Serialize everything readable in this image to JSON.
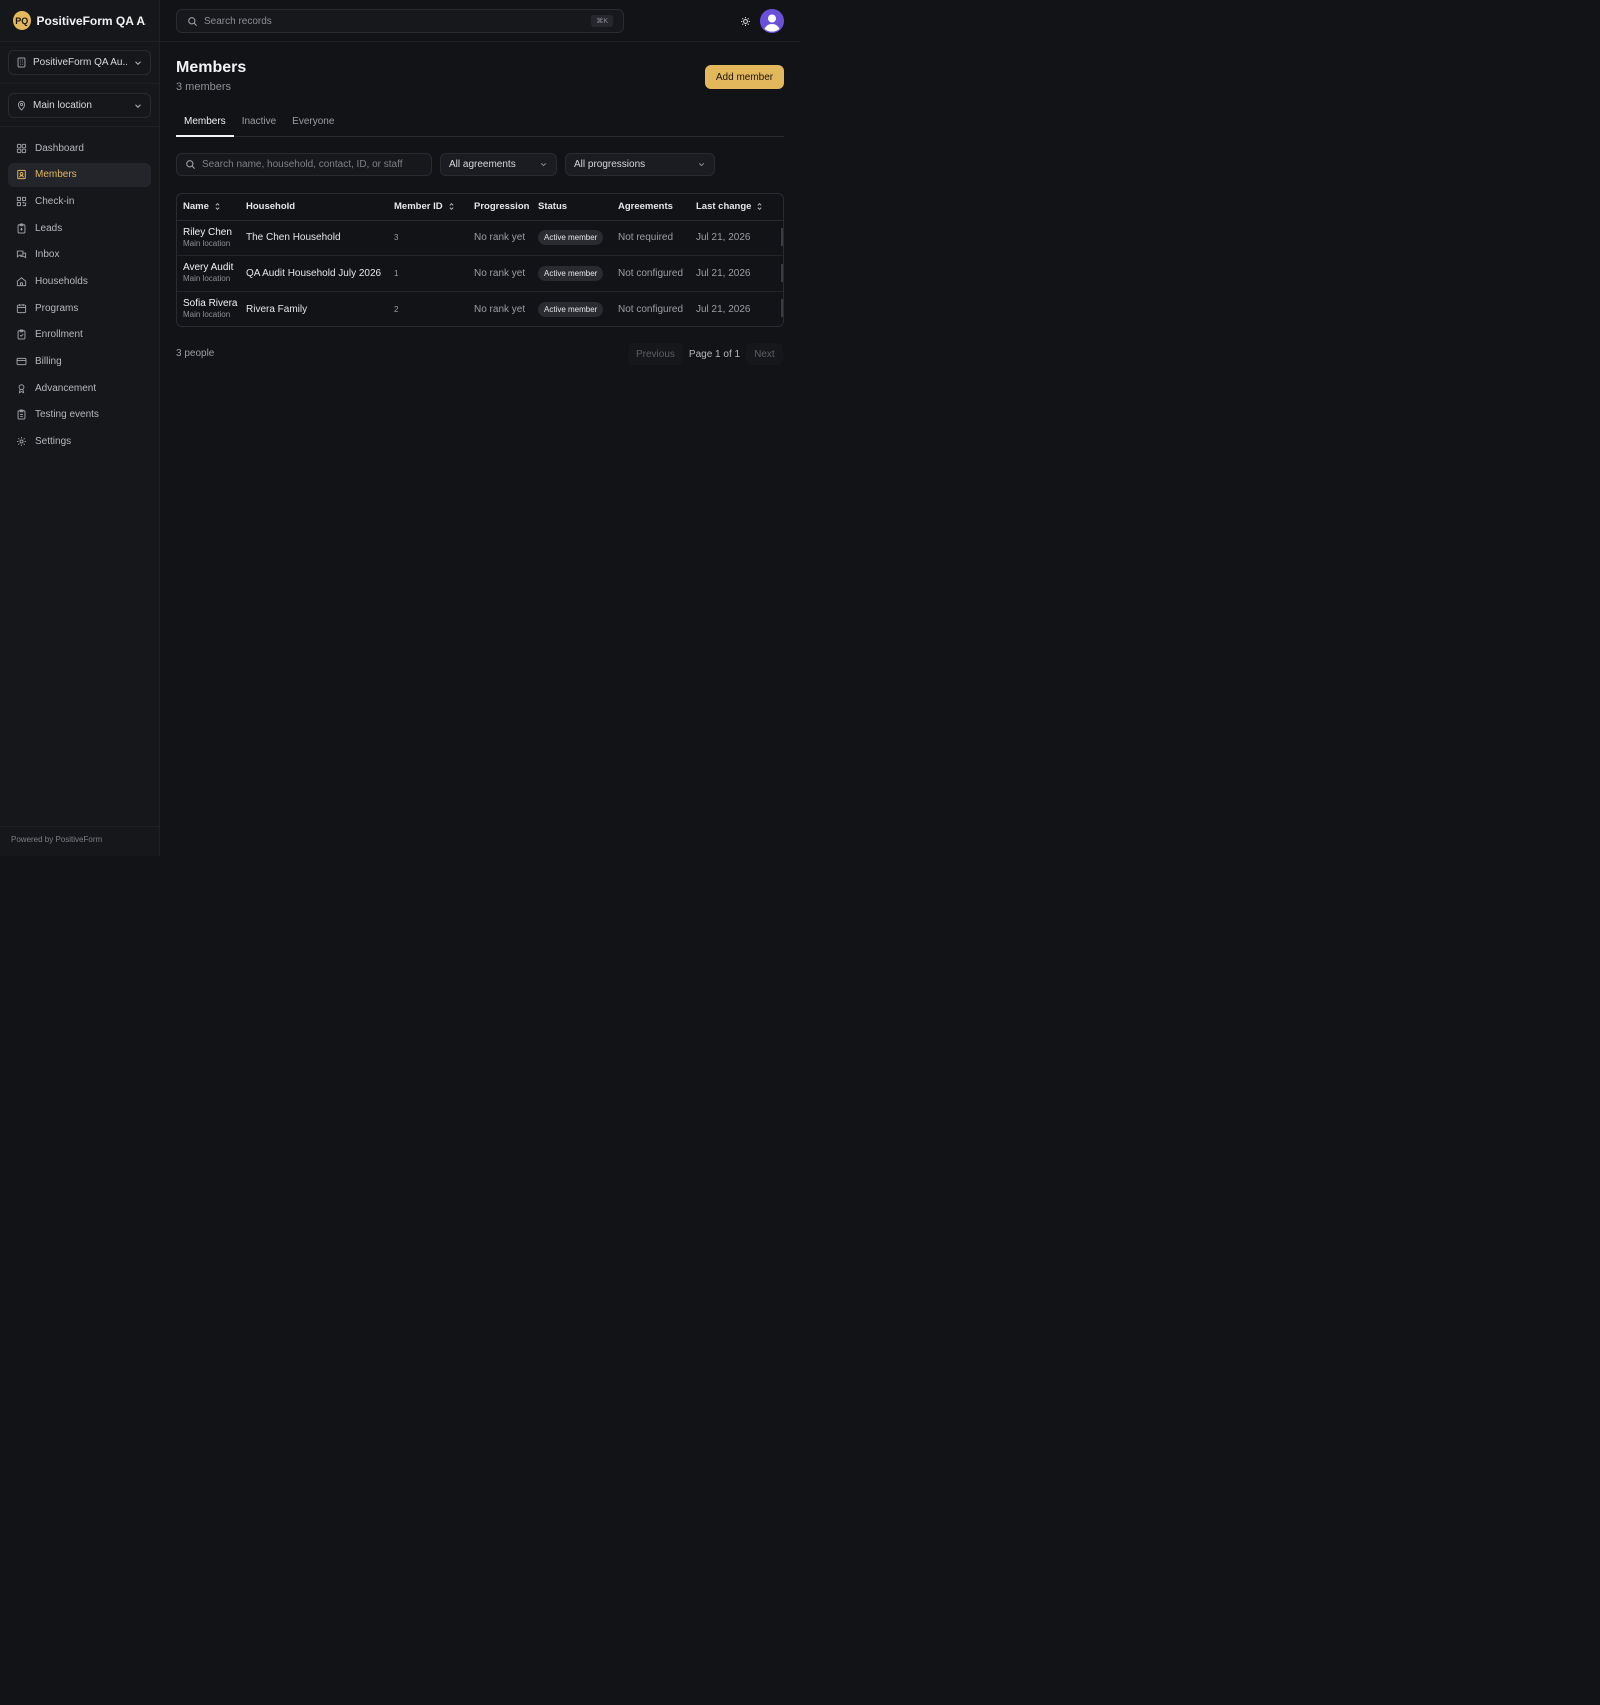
{
  "brand": {
    "initials": "PQ",
    "name": "PositiveForm QA A..."
  },
  "org_switcher": {
    "label": "PositiveForm QA Au...",
    "icon": "building-icon"
  },
  "location_switcher": {
    "label": "Main location",
    "icon": "map-pin-icon"
  },
  "sidebar": {
    "items": [
      {
        "label": "Dashboard",
        "icon": "grid-icon",
        "active": false
      },
      {
        "label": "Members",
        "icon": "id-badge-icon",
        "active": true
      },
      {
        "label": "Check-in",
        "icon": "qr-icon",
        "active": false
      },
      {
        "label": "Leads",
        "icon": "clipboard-icon",
        "active": false
      },
      {
        "label": "Inbox",
        "icon": "chat-icon",
        "active": false
      },
      {
        "label": "Households",
        "icon": "home-icon",
        "active": false
      },
      {
        "label": "Programs",
        "icon": "calendar-icon",
        "active": false
      },
      {
        "label": "Enrollment",
        "icon": "clipboard-check-icon",
        "active": false
      },
      {
        "label": "Billing",
        "icon": "credit-card-icon",
        "active": false
      },
      {
        "label": "Advancement",
        "icon": "award-icon",
        "active": false
      },
      {
        "label": "Testing events",
        "icon": "clipboard-list-icon",
        "active": false
      },
      {
        "label": "Settings",
        "icon": "gear-icon",
        "active": false
      }
    ],
    "footer": "Powered by PositiveForm"
  },
  "topbar": {
    "search_placeholder": "Search records",
    "shortcut": "⌘K"
  },
  "page": {
    "title": "Members",
    "subtitle": "3 members",
    "add_button": "Add member",
    "tabs": [
      {
        "label": "Members",
        "active": true
      },
      {
        "label": "Inactive",
        "active": false
      },
      {
        "label": "Everyone",
        "active": false
      }
    ],
    "filter_search_placeholder": "Search name, household, contact, ID, or staff",
    "agreements_filter": "All agreements",
    "progressions_filter": "All progressions"
  },
  "table": {
    "columns": [
      "Name",
      "Household",
      "Member ID",
      "Progression",
      "Status",
      "Agreements",
      "Last change"
    ],
    "rows": [
      {
        "name": "Riley Chen",
        "location": "Main location",
        "household": "The Chen Household",
        "member_id": "3",
        "progression": "No rank yet",
        "status": "Active member",
        "agreements": "Not required",
        "last_change": "Jul 21, 2026"
      },
      {
        "name": "Avery Audit",
        "location": "Main location",
        "household": "QA Audit Household July 2026",
        "member_id": "1",
        "progression": "No rank yet",
        "status": "Active member",
        "agreements": "Not configured",
        "last_change": "Jul 21, 2026"
      },
      {
        "name": "Sofia Rivera",
        "location": "Main location",
        "household": "Rivera Family",
        "member_id": "2",
        "progression": "No rank yet",
        "status": "Active member",
        "agreements": "Not configured",
        "last_change": "Jul 21, 2026"
      }
    ]
  },
  "footer": {
    "count": "3 people",
    "previous": "Previous",
    "page_info": "Page 1 of 1",
    "next": "Next"
  },
  "colors": {
    "accent": "#e3b75c",
    "background": "#121317",
    "avatar": "#6a4fd8"
  }
}
